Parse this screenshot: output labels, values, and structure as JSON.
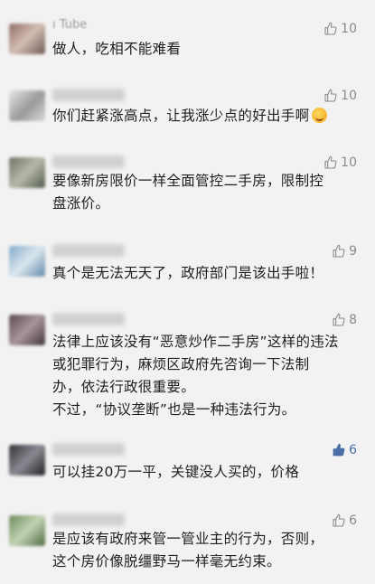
{
  "comments": [
    {
      "username": "ı Tube",
      "likes": "10",
      "liked": false,
      "lines": [
        "做人，吃相不能难看"
      ]
    },
    {
      "username": "",
      "likes": "10",
      "liked": false,
      "lines": [
        "你们赶紧涨高点，让我涨少点的好出手啊"
      ],
      "emoji": "grin-emoji"
    },
    {
      "username": "",
      "likes": "10",
      "liked": false,
      "lines": [
        "要像新房限价一样全面管控二手房，限制控",
        "盘涨价。"
      ]
    },
    {
      "username": "",
      "likes": "9",
      "liked": false,
      "lines": [
        "真个是无法无天了，政府部门是该出手啦！"
      ]
    },
    {
      "username": "",
      "likes": "8",
      "liked": false,
      "lines": [
        "法律上应该没有“恶意炒作二手房”这样的违法",
        "或犯罪行为，麻烦区政府先咨询一下法制",
        "办，依法行政很重要。",
        "不过，“协议垄断”也是一种违法行为。"
      ]
    },
    {
      "username": "",
      "likes": "6",
      "liked": true,
      "lines": [
        "可以挂20万一平，关键没人买的，价格"
      ]
    },
    {
      "username": "",
      "likes": "6",
      "liked": false,
      "lines": [
        "是应该有政府来管一管业主的行为，否则，",
        "这个房价像脱缰野马一样毫无约束。"
      ]
    }
  ],
  "icons": {
    "like": "thumbs-up-icon"
  },
  "colors": {
    "background": "#f2f2f2",
    "text": "#1e1e1e",
    "like_inactive": "#8a8a8a",
    "like_active": "#4a6fa8"
  }
}
